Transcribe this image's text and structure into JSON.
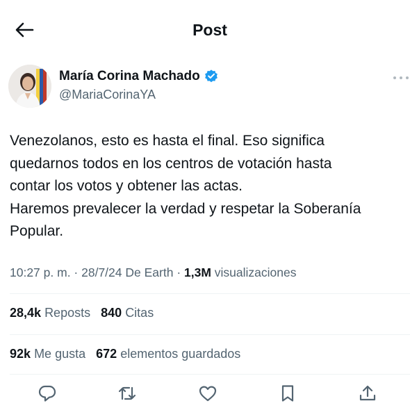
{
  "header": {
    "back_icon": "arrow-left-icon",
    "title": "Post"
  },
  "author": {
    "name": "María Corina Machado",
    "handle": "@MariaCorinaYA",
    "verified_icon": "verified-badge-icon",
    "verified_color": "#1d9bf0",
    "more_icon": "more-horizontal-icon"
  },
  "tweet": {
    "text": "Venezolanos, esto es hasta el final. Eso significa\nquedarnos todos en los centros de votación hasta\ncontar los votos y obtener las actas.\nHaremos prevalecer la verdad y respetar la Soberanía\nPopular."
  },
  "meta": {
    "time": "10:27 p. m.",
    "date": "28/7/24",
    "source": "De Earth",
    "views": "1,3M",
    "views_label": "visualizaciones"
  },
  "stats": {
    "reposts": "28,4k",
    "reposts_label": "Reposts",
    "quotes": "840",
    "quotes_label": "Citas",
    "likes": "92k",
    "likes_label": "Me gusta",
    "bookmarks": "672",
    "bookmarks_label": "elementos guardados"
  },
  "actions": {
    "reply_icon": "reply-icon",
    "repost_icon": "repost-icon",
    "like_icon": "heart-icon",
    "bookmark_icon": "bookmark-icon",
    "share_icon": "share-icon"
  },
  "colors": {
    "text": "#0f1419",
    "secondary": "#536471",
    "divider": "#eff3f4"
  }
}
